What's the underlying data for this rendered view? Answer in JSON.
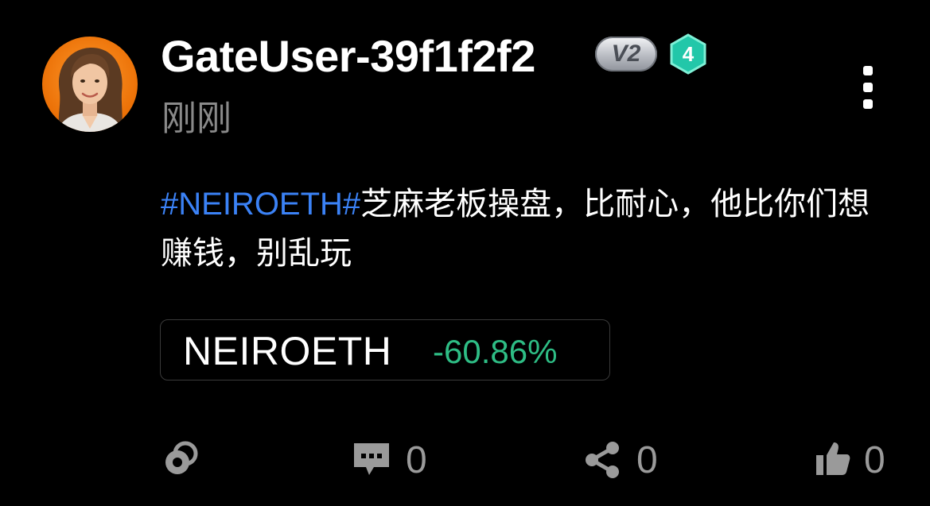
{
  "post": {
    "author": {
      "username": "GateUser-39f1f2f2",
      "vip_badge": "V2",
      "level_badge": "4",
      "avatar_icon": "avatar-woman-portrait"
    },
    "timestamp": "刚刚",
    "content": {
      "hashtag": "#NEIROETH#",
      "text": "芝麻老板操盘，比耐心，他比你们想赚钱，别乱玩"
    },
    "ticker": {
      "symbol": "NEIROETH",
      "change": "-60.86%",
      "change_color": "#2ebd85"
    },
    "actions": {
      "tip_icon": "coin-tip-icon",
      "comments": {
        "icon": "comment-icon",
        "count": "0"
      },
      "shares": {
        "icon": "share-icon",
        "count": "0"
      },
      "likes": {
        "icon": "thumbs-up-icon",
        "count": "0"
      }
    },
    "colors": {
      "background": "#000000",
      "hashtag": "#3b82f6",
      "muted": "#8a8a8a",
      "level_badge": "#22c7a9"
    }
  }
}
